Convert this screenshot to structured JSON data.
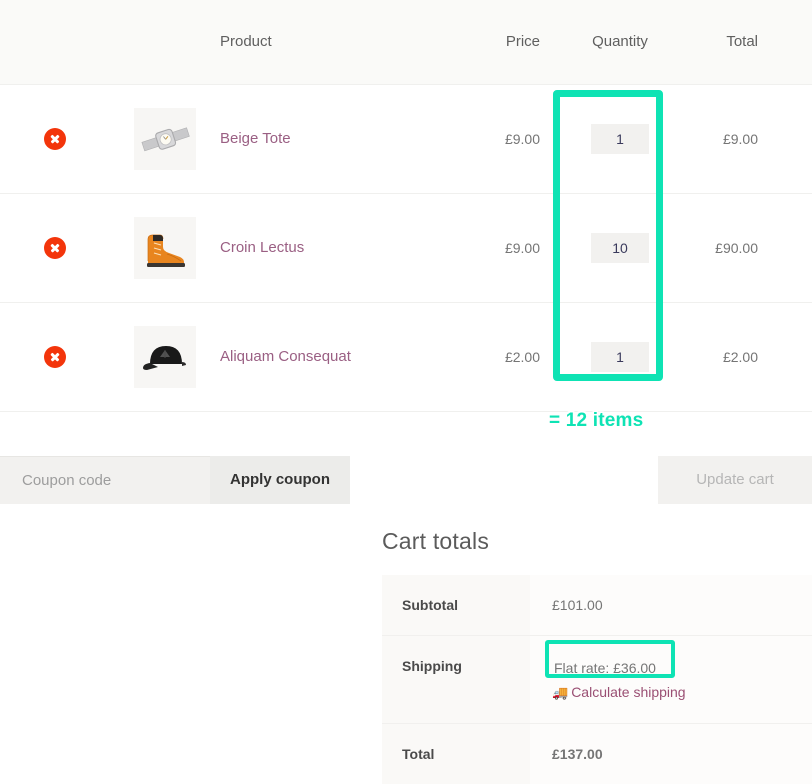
{
  "table": {
    "columns": {
      "remove": "",
      "thumbnail": "",
      "product": "Product",
      "price": "Price",
      "quantity": "Quantity",
      "total": "Total"
    },
    "rows": [
      {
        "remove_label": "Remove this item",
        "thumb_icon": "wristwatch-image",
        "product": "Beige Tote",
        "price": "£9.00",
        "quantity": "1",
        "total": "£9.00"
      },
      {
        "remove_label": "Remove this item",
        "thumb_icon": "boot-image",
        "product": "Croin Lectus",
        "price": "£9.00",
        "quantity": "10",
        "total": "£90.00"
      },
      {
        "remove_label": "Remove this item",
        "thumb_icon": "cap-image",
        "product": "Aliquam Consequat",
        "price": "£2.00",
        "quantity": "1",
        "total": "£2.00"
      }
    ]
  },
  "annotations": {
    "items_badge": "= 12 items",
    "highlight_color": "#0ee3b4"
  },
  "actions": {
    "coupon_placeholder": "Coupon code",
    "coupon_value": "",
    "apply_coupon_label": "Apply coupon",
    "update_cart_label": "Update cart"
  },
  "totals": {
    "title": "Cart totals",
    "subtotal_label": "Subtotal",
    "subtotal_value": "£101.00",
    "shipping_label": "Shipping",
    "shipping_rate": "Flat rate: £36.00",
    "calculate_shipping_label": "Calculate shipping",
    "calculate_shipping_icon": "truck-icon",
    "total_label": "Total",
    "total_value": "£137.00"
  }
}
